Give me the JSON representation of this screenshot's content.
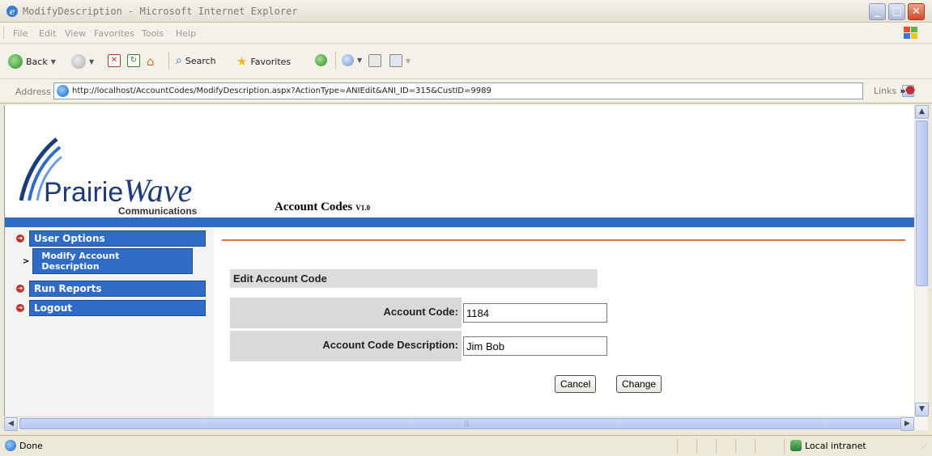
{
  "window": {
    "title": "ModifyDescription - Microsoft Internet Explorer"
  },
  "menu": {
    "items": [
      "File",
      "Edit",
      "View",
      "Favorites",
      "Tools",
      "Help"
    ]
  },
  "toolbar": {
    "back_label": "Back",
    "search_label": "Search",
    "favorites_label": "Favorites"
  },
  "address_bar": {
    "label": "Address",
    "url": "http://localhost/AccountCodes/ModifyDescription.aspx?ActionType=ANIEdit&ANI_ID=315&CustID=9989",
    "links_label": "Links"
  },
  "page": {
    "logo": {
      "word1": "Prairie",
      "word2": "Wave",
      "tagline": "Communications"
    },
    "app_title": "Account Codes",
    "app_version": "V1.0",
    "nav": {
      "user_options": "User Options",
      "modify_line1": "Modify Account",
      "modify_line2": "Description",
      "run_reports": "Run Reports",
      "logout": "Logout"
    },
    "form": {
      "header": "Edit Account Code",
      "account_code_label": "Account Code:",
      "account_code_value": "1184",
      "description_label": "Account Code Description:",
      "description_value": "Jim Bob",
      "cancel_label": "Cancel",
      "change_label": "Change"
    }
  },
  "status_bar": {
    "status": "Done",
    "zone": "Local intranet"
  }
}
